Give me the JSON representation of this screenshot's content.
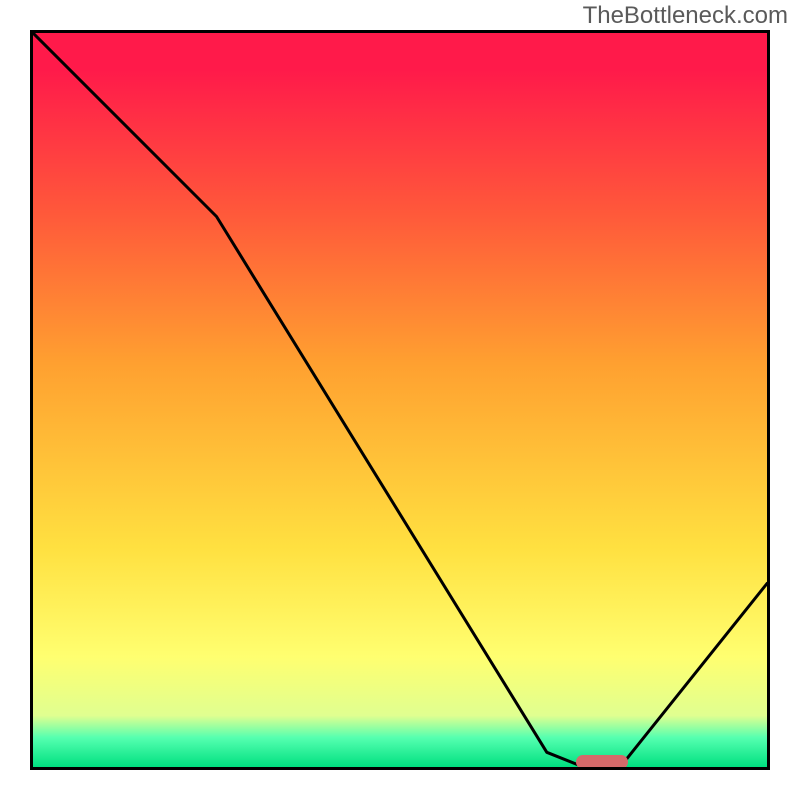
{
  "watermark": "TheBottleneck.com",
  "chart_data": {
    "type": "line",
    "title": "",
    "xlabel": "",
    "ylabel": "",
    "xlim": [
      0,
      100
    ],
    "ylim": [
      0,
      100
    ],
    "x": [
      0,
      25,
      70,
      75,
      80,
      100
    ],
    "values": [
      100,
      75,
      2,
      0,
      0,
      25
    ],
    "marker": {
      "x": 77.5,
      "y": 0,
      "width_pct": 7
    },
    "background_gradient_stops": [
      {
        "pos": 0,
        "color": "#ff1a4a"
      },
      {
        "pos": 5,
        "color": "#ff1a4a"
      },
      {
        "pos": 25,
        "color": "#ff5a3a"
      },
      {
        "pos": 45,
        "color": "#ffa030"
      },
      {
        "pos": 70,
        "color": "#ffe040"
      },
      {
        "pos": 85,
        "color": "#ffff70"
      },
      {
        "pos": 93,
        "color": "#e0ff90"
      },
      {
        "pos": 96,
        "color": "#55ffb0"
      },
      {
        "pos": 100,
        "color": "#00e080"
      }
    ]
  }
}
